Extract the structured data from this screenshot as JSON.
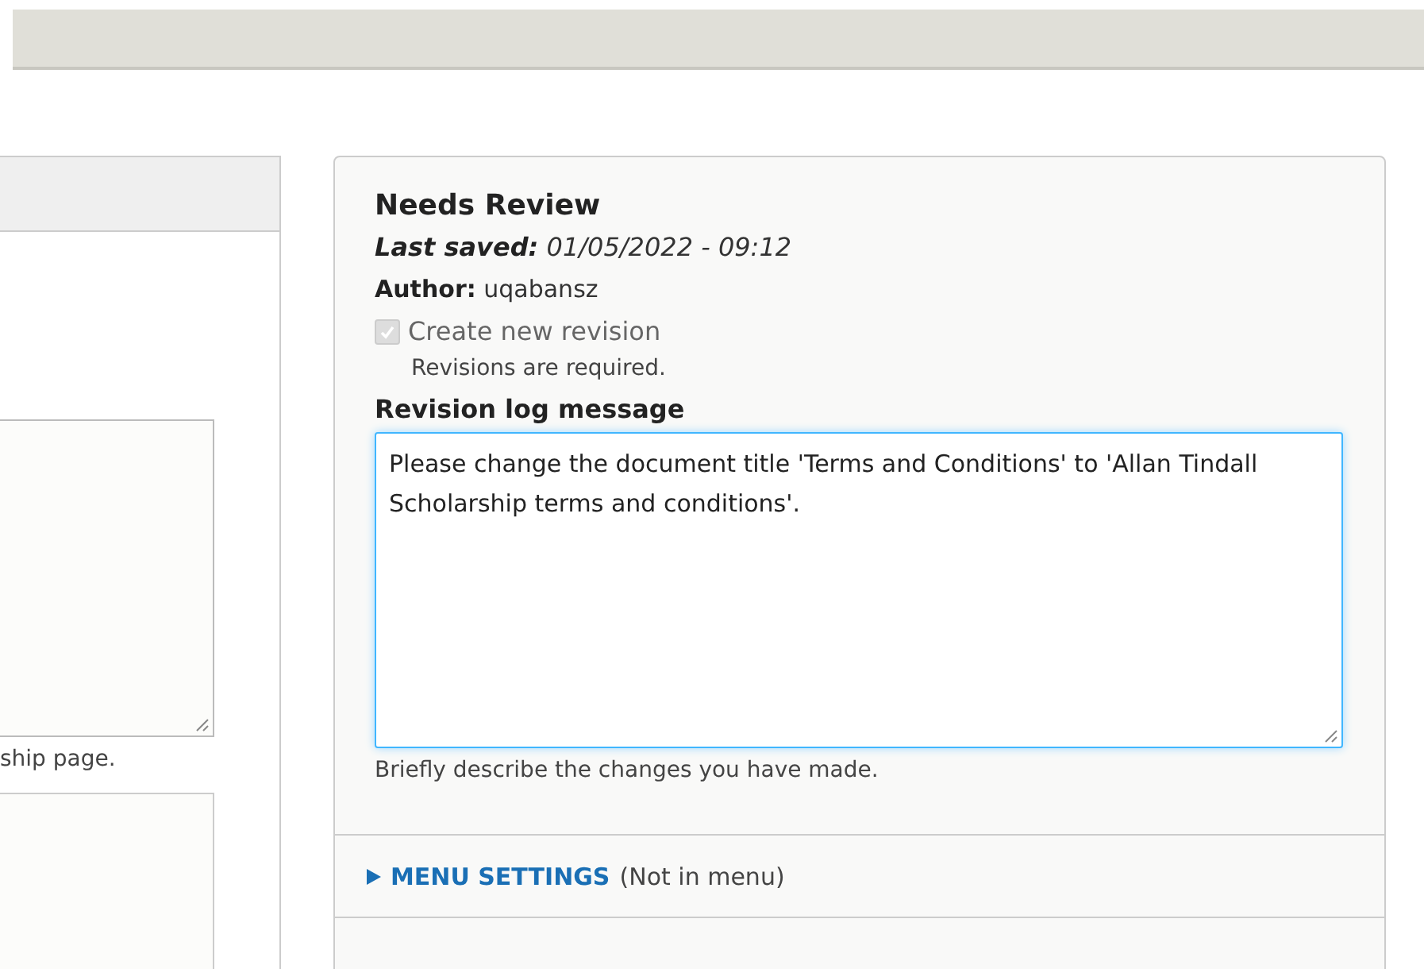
{
  "left_panel": {
    "help_text": "ship page."
  },
  "sidebar": {
    "status_title": "Needs Review",
    "last_saved": {
      "label": "Last saved:",
      "value": "01/05/2022 - 09:12"
    },
    "author": {
      "label": "Author:",
      "value": "uqabansz"
    },
    "create_revision": {
      "label": "Create new revision",
      "checked": true,
      "disabled": true,
      "description": "Revisions are required."
    },
    "revision_log": {
      "label": "Revision log message",
      "value": "Please change the document title 'Terms and Conditions' to 'Allan Tindall Scholarship terms and conditions'.",
      "description": "Briefly describe the changes you have made."
    },
    "menu_settings": {
      "label": "MENU SETTINGS",
      "summary": "(Not in menu)",
      "expanded": false
    }
  }
}
